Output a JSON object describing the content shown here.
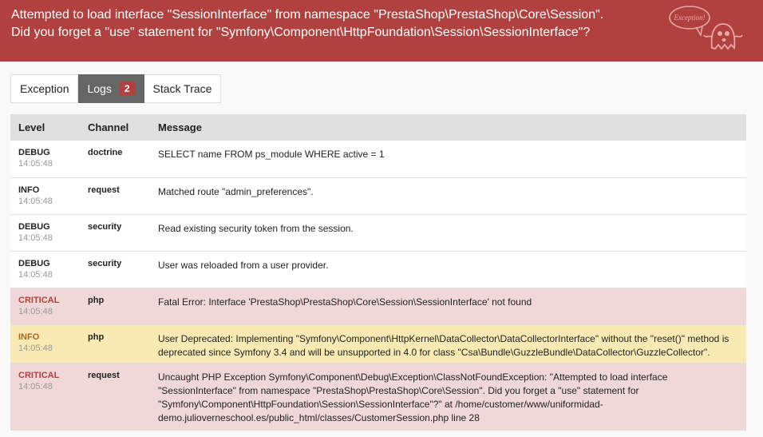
{
  "error": {
    "line1": "Attempted to load interface \"SessionInterface\" from namespace \"PrestaShop\\PrestaShop\\Core\\Session\".",
    "line2": "Did you forget a \"use\" statement for \"Symfony\\Component\\HttpFoundation\\Session\\SessionInterface\"?",
    "ghost_text": "Exception!"
  },
  "tabs": [
    {
      "label": "Exception"
    },
    {
      "label": "Logs",
      "count": "2"
    },
    {
      "label": "Stack Trace"
    }
  ],
  "logs": {
    "columns": [
      "Level",
      "Channel",
      "Message"
    ],
    "rows": [
      {
        "level": "DEBUG",
        "time": "14:05:48",
        "channel": "doctrine",
        "message": "SELECT name FROM ps_module WHERE active = 1"
      },
      {
        "level": "INFO",
        "time": "14:05:48",
        "channel": "request",
        "message": "Matched route \"admin_preferences\"."
      },
      {
        "level": "DEBUG",
        "time": "14:05:48",
        "channel": "security",
        "message": "Read existing security token from the session."
      },
      {
        "level": "DEBUG",
        "time": "14:05:48",
        "channel": "security",
        "message": "User was reloaded from a user provider."
      },
      {
        "level": "CRITICAL",
        "time": "14:05:48",
        "channel": "php",
        "message": "Fatal Error: Interface 'PrestaShop\\PrestaShop\\Core\\Session\\SessionInterface' not found"
      },
      {
        "level": "INFO",
        "time": "14:05:48",
        "channel": "php",
        "message": "User Deprecated: Implementing \"Symfony\\Component\\HttpKernel\\DataCollector\\DataCollectorInterface\" without the \"reset()\" method is deprecated since Symfony 3.4 and will be unsupported in 4.0 for class \"Csa\\Bundle\\GuzzleBundle\\DataCollector\\GuzzleCollector\"."
      },
      {
        "level": "CRITICAL",
        "time": "14:05:48",
        "channel": "request",
        "message": "Uncaught PHP Exception Symfony\\Component\\Debug\\Exception\\ClassNotFoundException: \"Attempted to load interface \"SessionInterface\" from namespace \"PrestaShop\\PrestaShop\\Core\\Session\". Did you forget a \"use\" statement for \"Symfony\\Component\\HttpFoundation\\Session\\SessionInterface\"?\" at /home/customer/www/uniformidad-demo.julioverneschool.es/public_html/classes/CustomerSession.php line 28"
      }
    ]
  }
}
